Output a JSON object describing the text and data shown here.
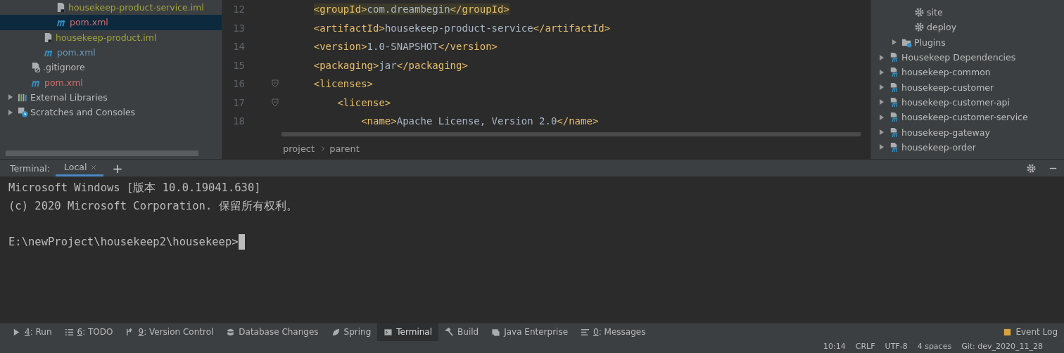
{
  "project_tree": [
    {
      "children": [
        {
          "children": [
            {
              "children": [
                {
                  "label": "housekeep-product-service.iml",
                  "kind": "iml",
                  "color": "#a0a33b",
                  "selected": false
                },
                {
                  "label": "pom.xml",
                  "kind": "maven",
                  "color": "#cc6e6e",
                  "selected": true
                }
              ]
            },
            {
              "label": "housekeep-product.iml",
              "kind": "iml",
              "color": "#a0a33b",
              "selected": false
            },
            {
              "label": "pom.xml",
              "kind": "maven",
              "color": "#6897bb",
              "selected": false
            }
          ]
        },
        {
          "label": ".gitignore",
          "kind": "ignore",
          "color": "#bbbbbb",
          "selected": false
        },
        {
          "label": "pom.xml",
          "kind": "maven",
          "color": "#cc6e6e",
          "selected": false
        }
      ]
    },
    {
      "label": "External Libraries",
      "kind": "library",
      "color": "#bbbbbb",
      "selected": false,
      "expanded": false
    },
    {
      "label": "Scratches and Consoles",
      "kind": "scratch",
      "color": "#bbbbbb",
      "selected": false,
      "expanded": false
    }
  ],
  "editor": {
    "lines": [
      {
        "number": "12",
        "code": "    <groupId>com.dreambegin</groupId>",
        "highlighted": true,
        "fold": false
      },
      {
        "number": "13",
        "code": "    <artifactId>housekeep-product-service</artifactId>",
        "highlighted": false,
        "fold": false
      },
      {
        "number": "14",
        "code": "    <version>1.0-SNAPSHOT</version>",
        "highlighted": false,
        "fold": false
      },
      {
        "number": "15",
        "code": "    <packaging>jar</packaging>",
        "highlighted": false,
        "fold": false
      },
      {
        "number": "16",
        "code": "    <licenses>",
        "highlighted": false,
        "fold": true
      },
      {
        "number": "17",
        "code": "        <license>",
        "highlighted": false,
        "fold": true
      },
      {
        "number": "18",
        "code": "            <name>Apache License, Version 2.0</name>",
        "highlighted": false,
        "fold": false
      }
    ],
    "breadcrumbs": [
      "project",
      "parent"
    ]
  },
  "maven_tree": [
    {
      "children": [
        {
          "children": [
            {
              "label": "site",
              "kind": "goal"
            },
            {
              "label": "deploy",
              "kind": "goal"
            }
          ]
        },
        {
          "label": "Plugins",
          "kind": "plugins",
          "expanded": false
        }
      ]
    },
    {
      "label": "Housekeep Dependencies",
      "kind": "module",
      "expanded": false
    },
    {
      "label": "housekeep-common",
      "kind": "module",
      "expanded": false
    },
    {
      "label": "housekeep-customer",
      "kind": "module",
      "expanded": false
    },
    {
      "label": "housekeep-customer-api",
      "kind": "module",
      "expanded": false
    },
    {
      "label": "housekeep-customer-service",
      "kind": "module",
      "expanded": false
    },
    {
      "label": "housekeep-gateway",
      "kind": "module",
      "expanded": false
    },
    {
      "label": "housekeep-order",
      "kind": "module",
      "expanded": false
    }
  ],
  "terminal": {
    "title": "Terminal:",
    "tabs": [
      {
        "label": "Local",
        "selected": true
      }
    ],
    "add": "+",
    "lines": [
      {
        "kind": "output",
        "text": "Microsoft Windows [版本 10.0.19041.630]"
      },
      {
        "kind": "output",
        "text": "(c) 2020 Microsoft Corporation. 保留所有权利。"
      },
      {
        "kind": "blank"
      },
      {
        "kind": "prompt",
        "text": "E:\\newProject\\housekeep2\\housekeep>"
      }
    ]
  },
  "tool_windows": [
    {
      "key": "4",
      "label": ": Run",
      "kind": "run",
      "selected": false
    },
    {
      "key": "6",
      "label": ": TODO",
      "kind": "todo",
      "selected": false
    },
    {
      "key": "9",
      "label": ": Version Control",
      "kind": "vcs",
      "selected": false
    },
    {
      "label": "Database Changes",
      "kind": "db",
      "selected": false
    },
    {
      "label": "Spring",
      "kind": "spring",
      "selected": false
    },
    {
      "label": "Terminal",
      "kind": "terminal",
      "selected": true
    },
    {
      "label": "Build",
      "kind": "build",
      "selected": false
    },
    {
      "label": "Java Enterprise",
      "kind": "javaee",
      "selected": false
    },
    {
      "key": "0",
      "label": ": Messages",
      "kind": "messages",
      "selected": false
    }
  ],
  "event_log": "Event Log",
  "status_bar": [
    "10:14",
    "CRLF",
    "UTF-8",
    "4 spaces",
    "Git: dev_2020_11_28"
  ]
}
